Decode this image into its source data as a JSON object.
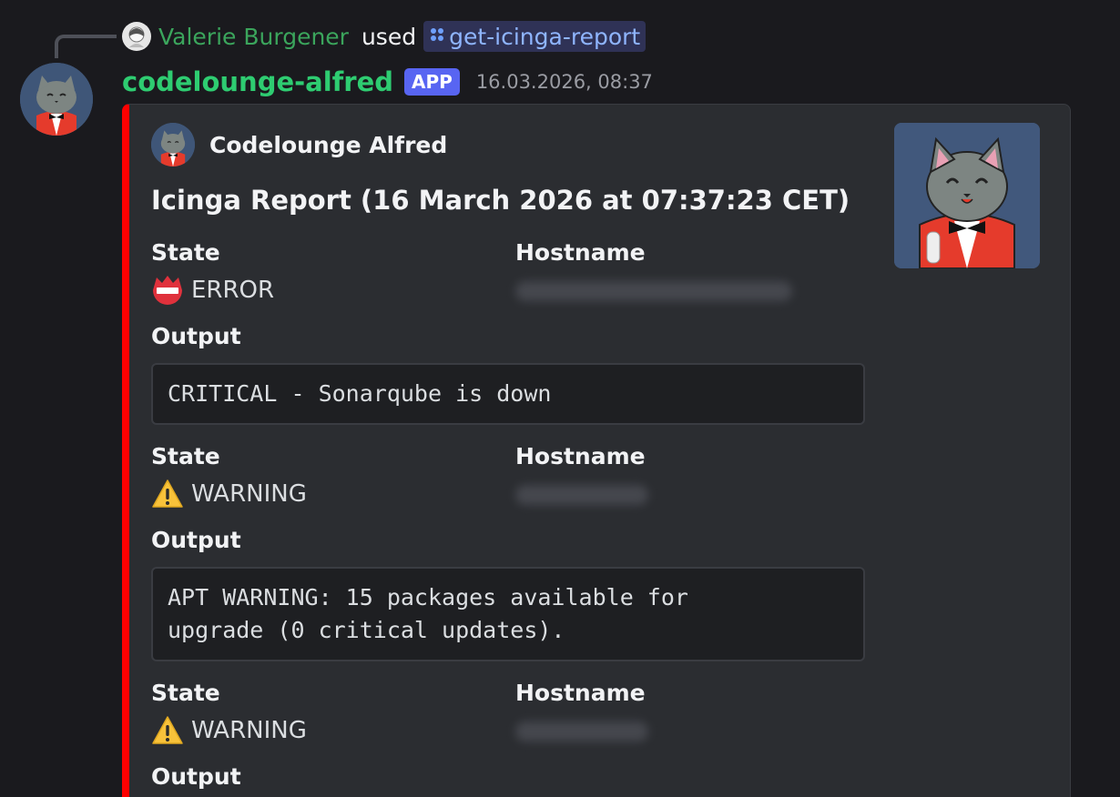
{
  "interaction": {
    "user": "Valerie Burgener",
    "used": "used",
    "command": "get-icinga-report"
  },
  "message": {
    "bot_name": "codelounge-alfred",
    "badge": "APP",
    "timestamp": "16.03.2026, 08:37"
  },
  "embed": {
    "accent_color": "#ff0000",
    "author": "Codelounge Alfred",
    "title": "Icinga Report (16 March 2026 at 07:37:23 CET)",
    "fields": [
      {
        "state_label": "State",
        "state_icon": "error-icon",
        "state": "ERROR",
        "hostname_label": "Hostname",
        "output_label": "Output",
        "output": "CRITICAL - Sonarqube is down"
      },
      {
        "state_label": "State",
        "state_icon": "warning-icon",
        "state": "WARNING",
        "hostname_label": "Hostname",
        "output_label": "Output",
        "output": "APT WARNING: 15 packages available for\nupgrade (0 critical updates)."
      },
      {
        "state_label": "State",
        "state_icon": "warning-icon",
        "state": "WARNING",
        "hostname_label": "Hostname",
        "output_label": "Output"
      }
    ]
  }
}
